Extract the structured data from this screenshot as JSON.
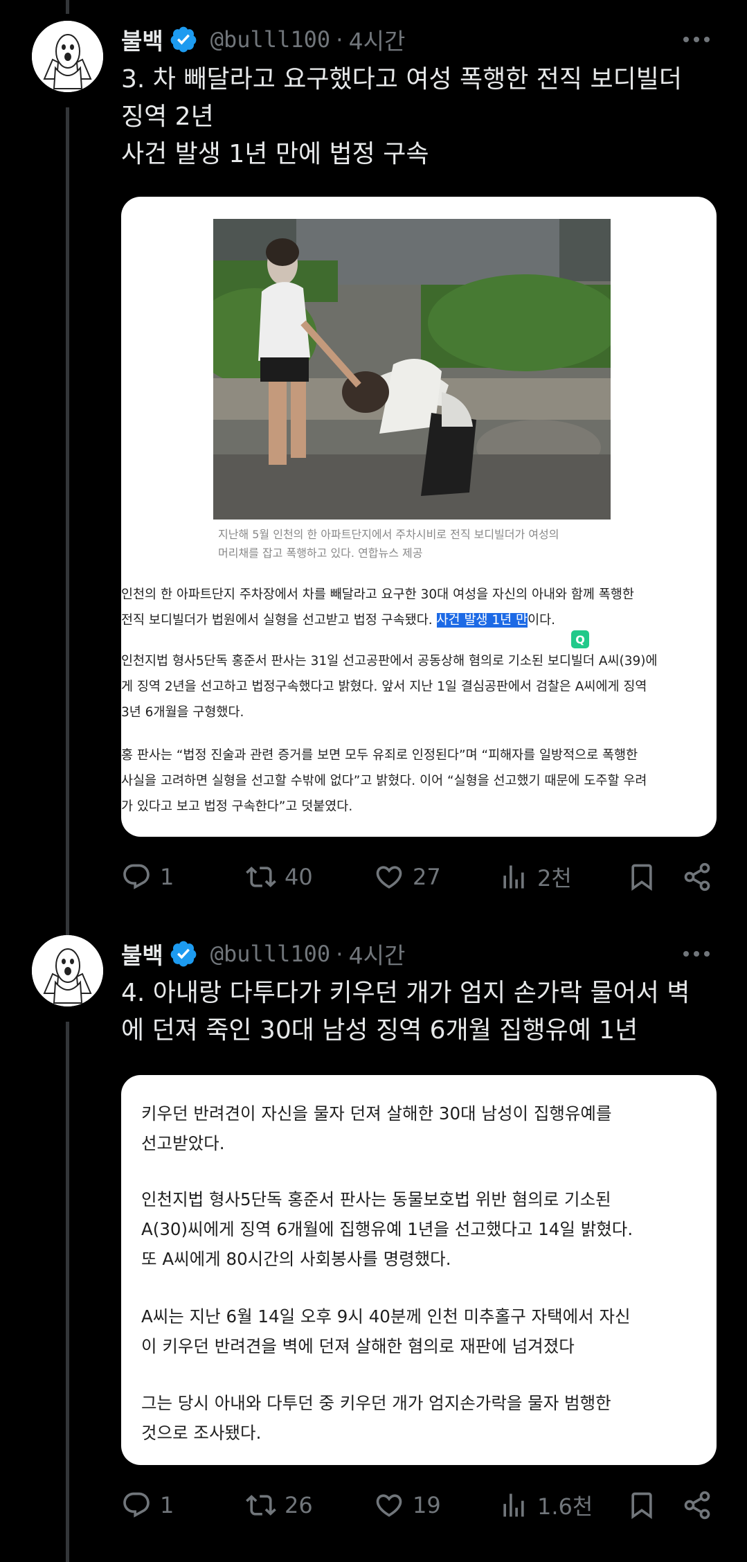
{
  "tweets": [
    {
      "author_name": "불백",
      "handle": "@bulll100",
      "separator": "·",
      "time": "4시간",
      "text_lines": [
        "3. 차 빼달라고 요구했다고 여성 폭행한 전직 보디빌더",
        "징역 2년",
        "사건 발생 1년 만에 법정 구속"
      ],
      "card": {
        "caption_lines": [
          "지난해 5월 인천의 한 아파트단지에서 주차시비로 전직 보디빌더가 여성의",
          "머리채를 잡고 폭행하고 있다. 연합뉴스 제공"
        ],
        "p1_line1": "인천의 한 아파트단지 주차장에서 차를 빼달라고 요구한 30대 여성을 자신의 아내와 함께 폭행한",
        "p1_line2_pre": "전직 보디빌더가 법원에서 실형을 선고받고 법정 구속됐다. ",
        "p1_line2_highlight": "사건 발생 1년 만",
        "p1_line2_post": "이다.",
        "badge": "Q",
        "p2_lines": [
          "인천지법 형사5단독 홍준서 판사는 31일 선고공판에서 공동상해 혐의로 기소된 보디빌더 A씨(39)에",
          "게 징역 2년을 선고하고 법정구속했다고 밝혔다. 앞서 지난 1일 결심공판에서 검찰은 A씨에게 징역",
          "3년 6개월을 구형했다."
        ],
        "p3_lines": [
          "홍 판사는 “법정 진술과 관련 증거를 보면 모두 유죄로 인정된다”며 “피해자를 일방적으로 폭행한",
          "사실을 고려하면 실형을 선고할 수밖에 없다”고 밝혔다. 이어 “실형을 선고했기 때문에 도주할 우려",
          "가 있다고 보고 법정 구속한다”고 덧붙였다."
        ]
      },
      "stats": {
        "replies": "1",
        "retweets": "40",
        "likes": "27",
        "views": "2천"
      }
    },
    {
      "author_name": "불백",
      "handle": "@bulll100",
      "separator": "·",
      "time": "4시간",
      "text_lines": [
        "4. 아내랑 다투다가 키우던 개가 엄지 손가락 물어서 벽",
        "에 던져 죽인 30대 남성 징역 6개월 집행유예 1년"
      ],
      "card": {
        "p1_lines": [
          "키우던 반려견이 자신을 물자 던져 살해한 30대 남성이 집행유예를",
          "선고받았다."
        ],
        "p2_lines": [
          "인천지법 형사5단독 홍준서 판사는 동물보호법 위반 혐의로 기소된",
          "A(30)씨에게 징역 6개월에 집행유예 1년을 선고했다고 14일 밝혔다.",
          "또 A씨에게 80시간의 사회봉사를 명령했다."
        ],
        "p3_lines": [
          "A씨는 지난 6월 14일 오후 9시 40분께 인천 미추홀구 자택에서 자신",
          "이 키우던 반려견을 벽에 던져 살해한 혐의로 재판에 넘겨졌다"
        ],
        "p4_lines": [
          "그는 당시 아내와 다투던 중 키우던 개가 엄지손가락을 물자 범행한",
          "것으로 조사됐다."
        ]
      },
      "stats": {
        "replies": "1",
        "retweets": "26",
        "likes": "19",
        "views": "1.6천"
      }
    }
  ],
  "colors": {
    "background": "#000000",
    "text": "#e7e9ea",
    "secondary": "#71767b",
    "verified": "#1d9bf0",
    "highlight": "#1d6ae5"
  },
  "icons": [
    "more-icon",
    "verified-badge-icon",
    "reply-icon",
    "retweet-icon",
    "like-icon",
    "views-icon",
    "bookmark-icon",
    "share-icon"
  ]
}
